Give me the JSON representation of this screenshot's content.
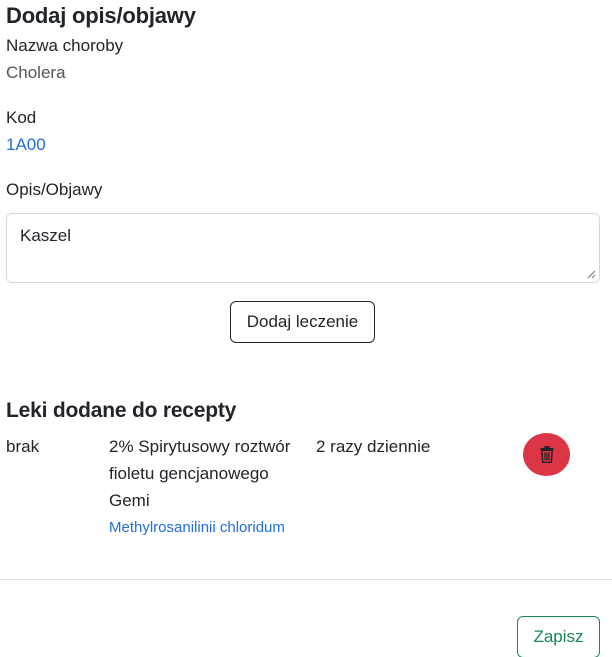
{
  "modal": {
    "title": "Dodaj opis/objawy"
  },
  "disease": {
    "name_label": "Nazwa choroby",
    "name_value": "Cholera",
    "code_label": "Kod",
    "code_value": "1A00"
  },
  "description": {
    "label": "Opis/Objawy",
    "value": "Kaszel"
  },
  "actions": {
    "add_treatment_label": "Dodaj leczenie",
    "save_label": "Zapisz"
  },
  "prescription": {
    "title": "Leki dodane do recepty",
    "items": [
      {
        "col1": "brak",
        "drug_name": "2% Spirytusowy roztwór fioletu gencjanowego Gemi",
        "substance": "Methylrosanilinii chloridum",
        "dosage": "2 razy dziennie"
      }
    ]
  },
  "icons": {
    "delete": "trash-icon",
    "resize": "resize-grip-icon"
  },
  "colors": {
    "link": "#1f6fe0",
    "danger": "#dc3545",
    "success": "#198754"
  }
}
